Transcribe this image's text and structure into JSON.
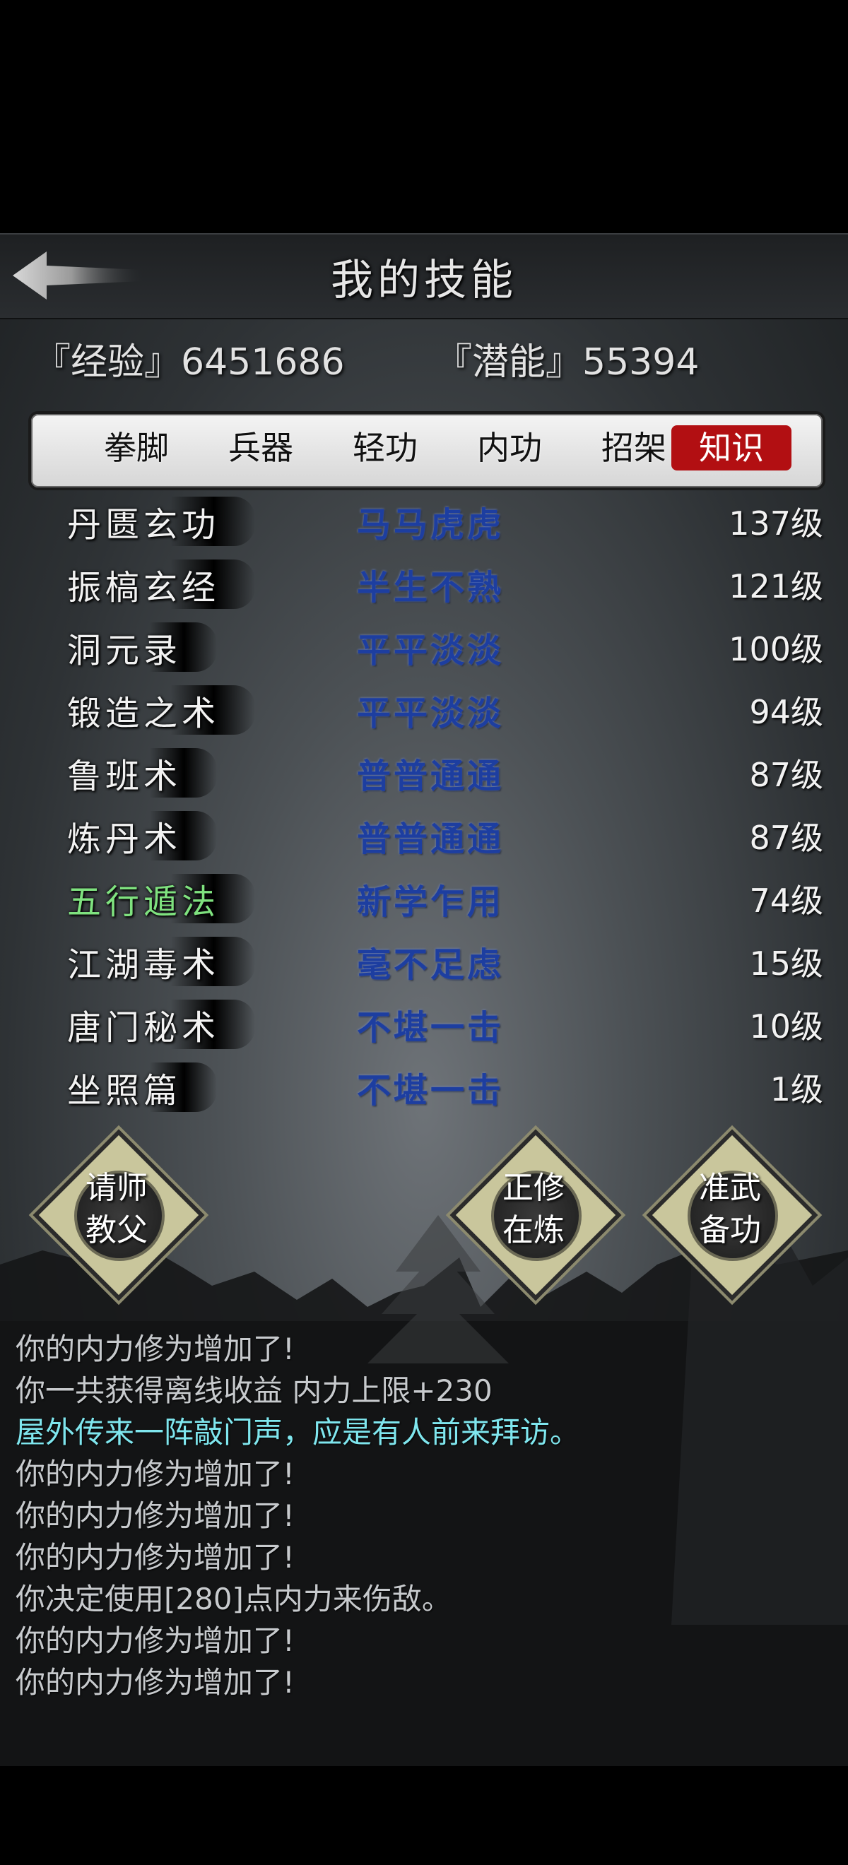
{
  "header": {
    "title": "我的技能"
  },
  "stats": {
    "experience": "『经验』6451686",
    "potential": "『潜能』55394"
  },
  "tabs": [
    {
      "label": "拳脚",
      "active": false
    },
    {
      "label": "兵器",
      "active": false
    },
    {
      "label": "轻功",
      "active": false
    },
    {
      "label": "内功",
      "active": false
    },
    {
      "label": "招架",
      "active": false
    },
    {
      "label": "知识",
      "active": true
    }
  ],
  "skills": [
    {
      "name": "丹匮玄功",
      "proficiency": "马马虎虎",
      "level": "137级"
    },
    {
      "name": "振槁玄经",
      "proficiency": "半生不熟",
      "level": "121级"
    },
    {
      "name": "洞元录",
      "proficiency": "平平淡淡",
      "level": "100级"
    },
    {
      "name": "锻造之术",
      "proficiency": "平平淡淡",
      "level": "94级"
    },
    {
      "name": "鲁班术",
      "proficiency": "普普通通",
      "level": "87级"
    },
    {
      "name": "炼丹术",
      "proficiency": "普普通通",
      "level": "87级"
    },
    {
      "name": "五行遁法",
      "proficiency": "新学乍用",
      "level": "74级",
      "highlight": true
    },
    {
      "name": "江湖毒术",
      "proficiency": "毫不足虑",
      "level": "15级"
    },
    {
      "name": "唐门秘术",
      "proficiency": "不堪一击",
      "level": "10级"
    },
    {
      "name": "坐照篇",
      "proficiency": "不堪一击",
      "level": "1级"
    }
  ],
  "actions": {
    "teacher": {
      "line1": "请师",
      "line2": "教父"
    },
    "practice": {
      "line1": "正修",
      "line2": "在炼"
    },
    "prepare": {
      "line1": "准武",
      "line2": "备功"
    }
  },
  "log": [
    "你的内力修为增加了!",
    "你一共获得离线收益 内力上限+230",
    "屋外传来一阵敲门声，应是有人前来拜访。",
    "你的内力修为增加了!",
    "你的内力修为增加了!",
    "你的内力修为增加了!",
    "你决定使用[280]点内力来伤敌。",
    "你的内力修为增加了!",
    "你的内力修为增加了!"
  ],
  "colors": {
    "active_tab": "#b20f12",
    "proficiency_text": "#1d3ea0",
    "highlight_skill": "#7fe27f",
    "event_log_text": "#7fe6ee"
  }
}
